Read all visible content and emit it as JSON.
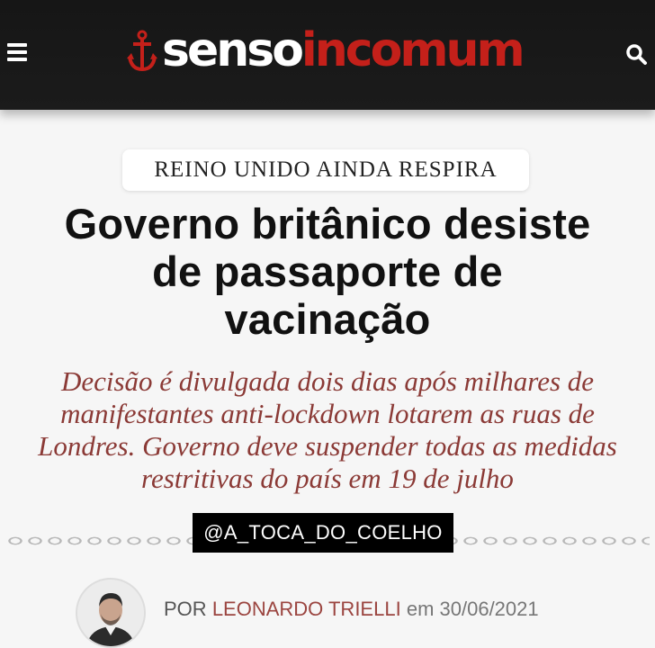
{
  "header": {
    "logo_text_a": "senso",
    "logo_text_b": "incomum",
    "menu_icon": "hamburger-menu-icon",
    "search_icon": "search-icon",
    "logo_icon": "anchor-icon",
    "colors": {
      "bar": "#171717",
      "brand_red": "#c4201a"
    }
  },
  "article": {
    "kicker": "REINO UNIDO AINDA RESPIRA",
    "headline_lines": [
      "Governo britânico desiste",
      "de passaporte de",
      "vacinação"
    ],
    "subhead_lines": [
      "Decisão é divulgada dois dias após milhares de",
      "manifestantes anti-lockdown lotarem as ruas de",
      "Londres. Governo deve suspender todas as medidas",
      "restritivas do país em 19 de julho"
    ],
    "byline": {
      "prefix": "POR",
      "author": "LEONARDO TRIELLI",
      "connector": "em",
      "date": "30/06/2021"
    }
  },
  "watermark": {
    "handle": "@A_TOCA_DO_COELHO"
  }
}
